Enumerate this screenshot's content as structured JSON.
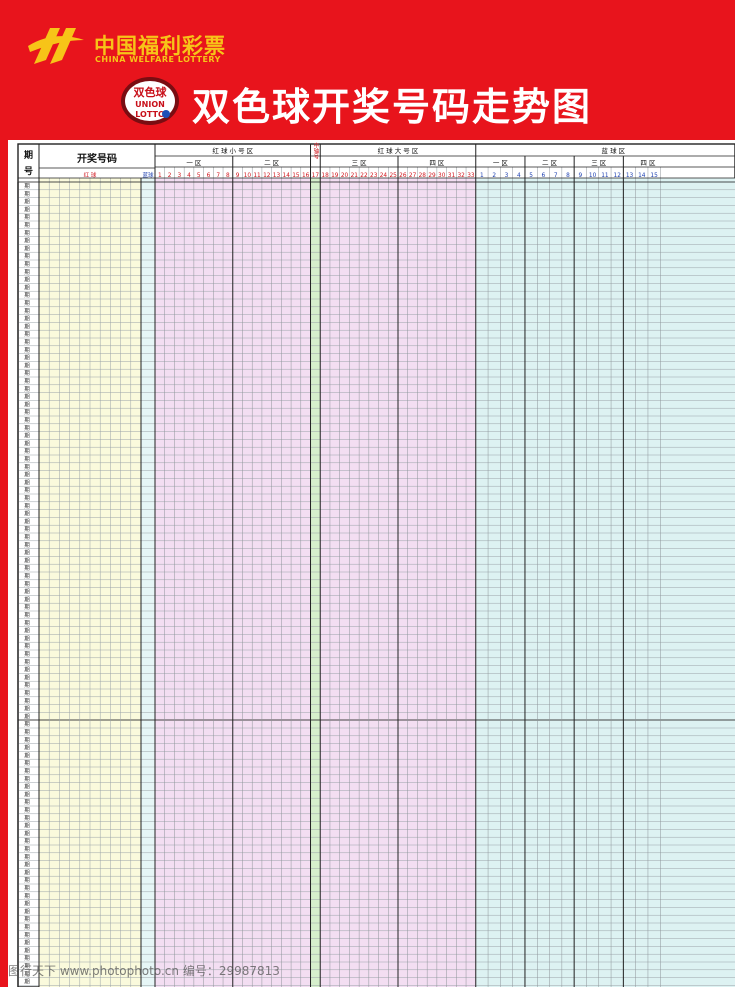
{
  "brand": {
    "name_cn": "中国福利彩票",
    "name_en": "CHINA WELFARE LOTTERY"
  },
  "badge": {
    "text_cn": "双色球",
    "text_en_1": "UNION",
    "text_en_2": "LOTTO"
  },
  "title": "双色球开奖号码走势图",
  "table": {
    "period_header_1": "期",
    "period_header_2": "号",
    "winning_numbers_header": "开奖号码",
    "red_ball_label": "红  球",
    "blue_ball_label": "蓝球",
    "red_small_zone": "红  球  小  号  区",
    "red_big_zone": "红  球  大  号  区",
    "blue_zone": "蓝  球  区",
    "middle_column": "中轴号",
    "zone_1": "一  区",
    "zone_2": "二  区",
    "zone_3": "三  区",
    "zone_4": "四  区",
    "blue_zone_1": "一  区",
    "blue_zone_2": "二  区",
    "blue_zone_3": "三  区",
    "blue_zone_4": "四  区",
    "row_label": "期",
    "red_numbers": [
      "1",
      "2",
      "3",
      "4",
      "5",
      "6",
      "7",
      "8",
      "9",
      "10",
      "11",
      "12",
      "13",
      "14",
      "15",
      "16",
      "17",
      "18",
      "19",
      "20",
      "21",
      "22",
      "23",
      "24",
      "25",
      "26",
      "27",
      "28",
      "29",
      "30",
      "31",
      "32",
      "33"
    ],
    "blue_numbers": [
      "1",
      "2",
      "3",
      "4",
      "5",
      "6",
      "7",
      "8",
      "9",
      "10",
      "11",
      "12",
      "13",
      "14",
      "15"
    ]
  },
  "colors": {
    "red_background": "#e8141c",
    "brand_yellow": "#f7c418",
    "result_fill": "#fafadc",
    "blue_result_fill": "#e6f6f6",
    "red_zone_fill": "#f3def2",
    "middle_fill": "#d6efcc",
    "blue_zone_fill": "#ddf2f2"
  },
  "watermark": "图行天下  www.photophoto.cn  编号：29987813"
}
